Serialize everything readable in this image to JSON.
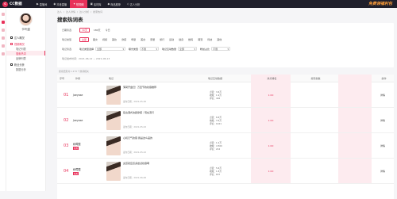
{
  "brand": {
    "logo_letter": "C",
    "name": "CC数据",
    "promo": "免费领福利包"
  },
  "topnav": [
    {
      "label": "直播间",
      "icon": "▶"
    },
    {
      "label": "抖音直播",
      "icon": "◉"
    },
    {
      "label": "短视频",
      "icon": "✦"
    },
    {
      "label": "素材库",
      "icon": "▣"
    },
    {
      "label": "商品推荐",
      "icon": "◆"
    },
    {
      "label": "达人分析",
      "icon": "◇"
    }
  ],
  "user": {
    "name": "卡叶迪"
  },
  "menu": {
    "items": [
      {
        "label": "达人概况",
        "type": "head"
      },
      {
        "label": "视频概况",
        "type": "head red"
      },
      {
        "label": "笔记列表",
        "type": "sub"
      },
      {
        "label": "搜索热词",
        "type": "sub active"
      },
      {
        "label": "品牌列表",
        "type": "sub"
      },
      {
        "label": "粉丝分析",
        "type": "head"
      },
      {
        "label": "数据分析",
        "type": "sub"
      }
    ]
  },
  "breadcrumb": [
    "达人",
    "/",
    "达人详情",
    "/",
    "达人分析",
    "/",
    "搜索热词"
  ],
  "page_title": "搜索热词表",
  "filters": {
    "row1_label": "日期筛选",
    "row1_chips": [
      "30天",
      "180天",
      "今日"
    ],
    "row2_label": "笔记类型",
    "row2_chips": [
      "全部",
      "图文",
      "视频",
      "美妆",
      "穿搭",
      "母婴",
      "美食",
      "家居",
      "旅行",
      "运动",
      "健身",
      "数码",
      "萌宠",
      "科技",
      "其他"
    ],
    "row3_label": "笔记筛选",
    "selects": [
      {
        "label": "笔记类型选择",
        "value": "全部"
      },
      {
        "label": "曝光类型",
        "value": "不限"
      },
      {
        "label": "笔记互动数量",
        "value": "全部"
      },
      {
        "label": "粉丝占比",
        "value": "不限"
      }
    ],
    "row4_text": "笔记发布时间：2021-06-12 ~ 2021-06-13"
  },
  "count_text": "搜索结果共 1 273 个热词相关",
  "headers": [
    "序号",
    "作者",
    "笔记",
    "笔记互动数据",
    "热词排名",
    "搜索指数",
    "操作"
  ],
  "rows": [
    {
      "idx": "01",
      "author": "Joeyase",
      "tag": "",
      "title": "薄荷开盘扫！万圣节的妆容推荐",
      "date": "发布日期：2021-05-26",
      "stats": [
        "点赞：3.6万",
        "收藏：1.9万",
        "评论：402"
      ],
      "rank": "1:00",
      "action": "详情"
    },
    {
      "idx": "02",
      "author": "Joeyase",
      "tag": "",
      "title": "复古港式浓颜穿搭｜现在流行",
      "date": "发布日期：2021-05-02",
      "stats": [
        "点赞：8.8万",
        "收藏：3.9万",
        "评论：1421"
      ],
      "rank": "1:00",
      "action": "详情"
    },
    {
      "idx": "03",
      "author": "树莓酸",
      "tag": "新秀",
      "title": "心机元气妆容 我是这么画的",
      "date": "发布日期：2021-05-22",
      "stats": [
        "点赞：1.2万",
        "收藏：4 500",
        "评论：212"
      ],
      "rank": "1:00",
      "action": "详情"
    },
    {
      "idx": "04",
      "author": "树莓酸",
      "tag": "新秀",
      "title": "女孩就应该多尝试妆容啊",
      "date": "发布日期：2021-06-06",
      "stats": [
        "点赞：5.6万",
        "收藏：1.8万",
        "评论：637"
      ],
      "rank": "1:00",
      "action": "详情"
    }
  ]
}
